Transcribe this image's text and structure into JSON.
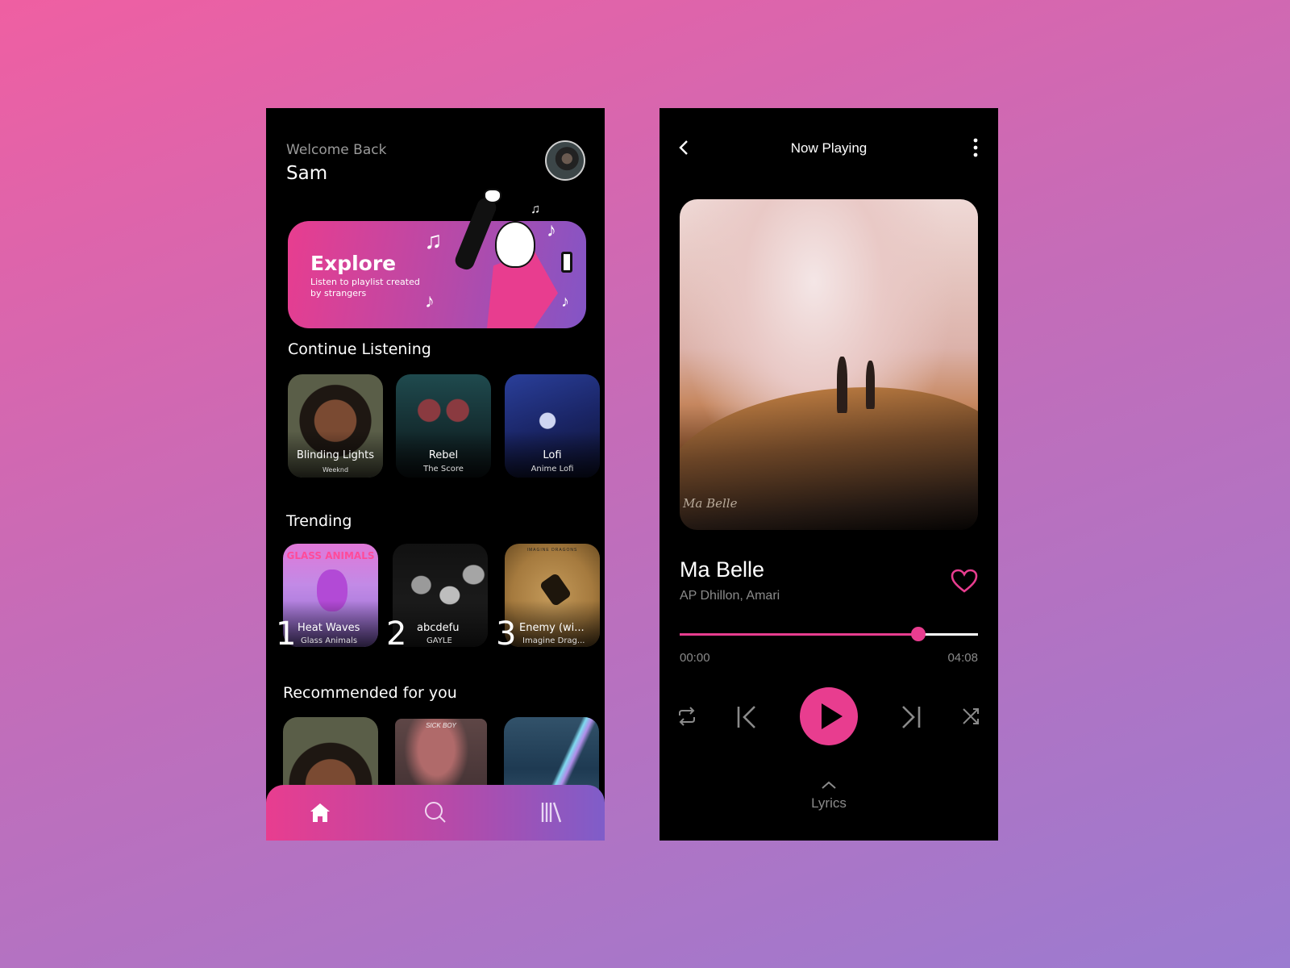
{
  "home": {
    "greeting": "Welcome Back",
    "user_name": "Sam",
    "banner": {
      "title": "Explore",
      "subtitle": "Listen to playlist created by strangers"
    },
    "continue_listening": {
      "title": "Continue Listening",
      "items": [
        {
          "title": "Blinding Lights",
          "artist": "Weeknd"
        },
        {
          "title": "Rebel",
          "artist": "The Score"
        },
        {
          "title": "Lofi",
          "artist": "Anime Lofi"
        }
      ]
    },
    "trending": {
      "title": "Trending",
      "items": [
        {
          "rank": "1",
          "title": "Heat Waves",
          "artist": "Glass Animals",
          "art_text": "GLASS ANIMALS"
        },
        {
          "rank": "2",
          "title": "abcdefu",
          "artist": "GAYLE"
        },
        {
          "rank": "3",
          "title": "Enemy (wi...",
          "artist": "Imagine Drag...",
          "art_text": "IMAGINE DRAGONS"
        }
      ]
    },
    "recommended": {
      "title": "Recommended for you",
      "items": [
        {
          "art": "weeknd-cover"
        },
        {
          "art": "sick-boy-cover",
          "art_text": "SICK BOY"
        },
        {
          "art": "comet-sky-cover"
        }
      ]
    },
    "nav": [
      {
        "icon": "home-icon",
        "label": "Home",
        "active": true
      },
      {
        "icon": "search-icon",
        "label": "Search",
        "active": false
      },
      {
        "icon": "library-icon",
        "label": "Library",
        "active": false
      }
    ]
  },
  "player": {
    "header_title": "Now Playing",
    "album_signature": "Ma Belle",
    "song_title": "Ma Belle",
    "artist": "AP Dhillon, Amari",
    "liked": false,
    "progress_fraction": 0.8,
    "time_elapsed": "00:00",
    "time_total": "04:08",
    "lyrics_label": "Lyrics"
  },
  "colors": {
    "accent": "#e83d8f",
    "accent_secondary": "#7f5dc9",
    "muted_text": "#8a8a8a"
  }
}
